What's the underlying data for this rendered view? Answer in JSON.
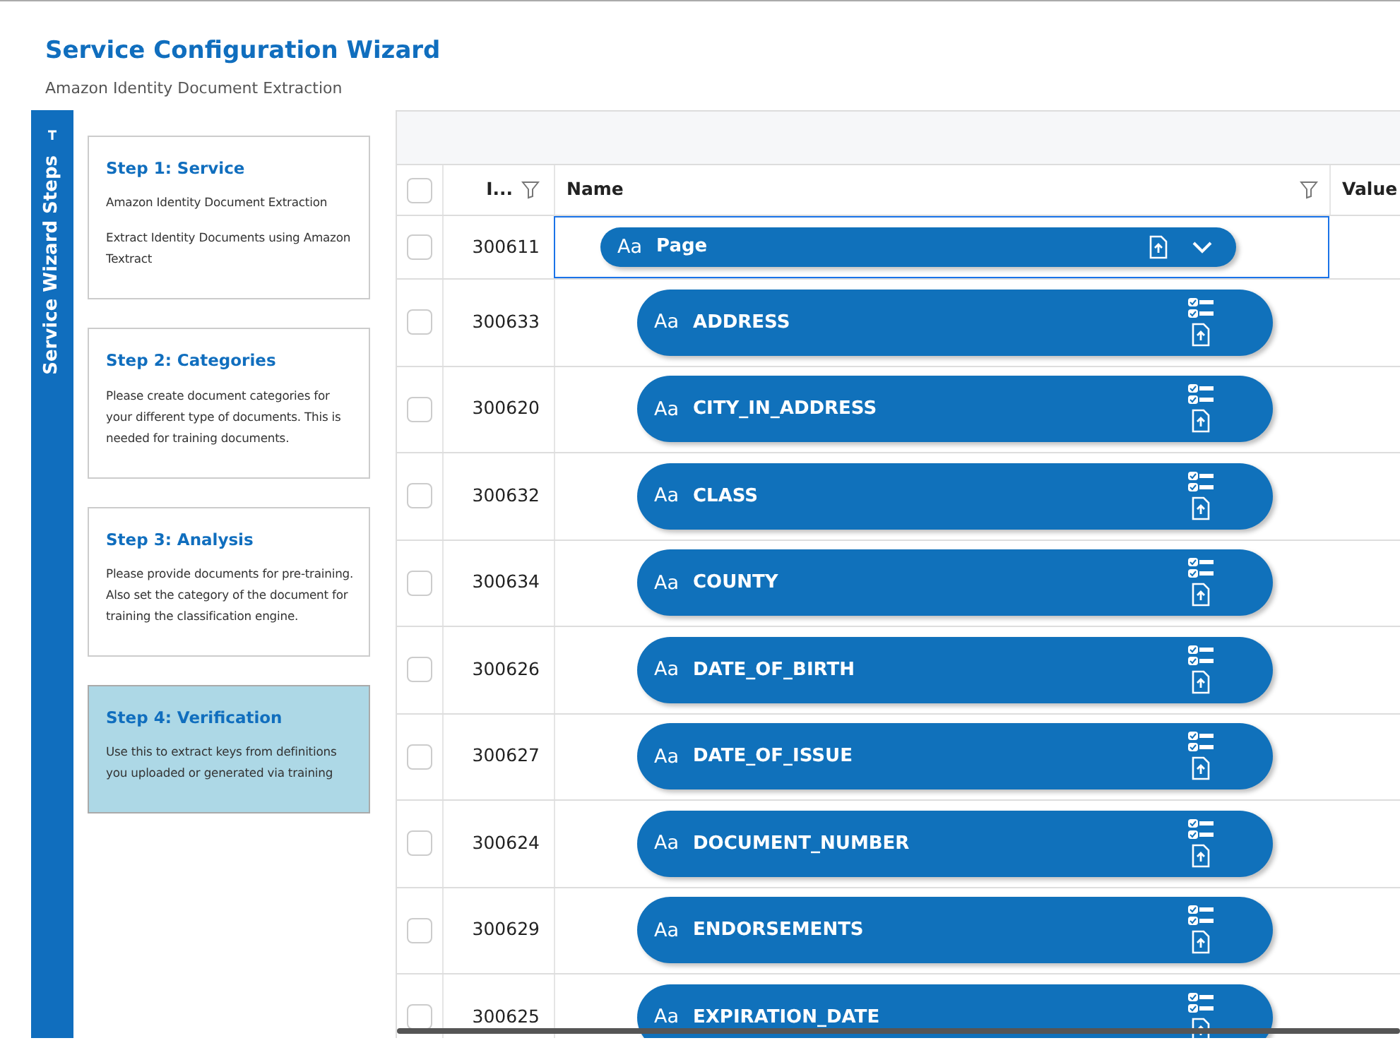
{
  "window": {
    "title": "Service Configuration Wizard",
    "subtitle": "Amazon Identity Document Extraction"
  },
  "sidebar": {
    "title": "Service Wizard Steps"
  },
  "steps": [
    {
      "title": "Step 1: Service",
      "lines": [
        "Amazon Identity Document Extraction",
        "Extract Identity Documents using Amazon Textract"
      ],
      "selected": false
    },
    {
      "title": "Step 2: Categories",
      "lines": [
        "Please create document categories for your different type of documents. This is needed for training documents."
      ],
      "selected": false
    },
    {
      "title": "Step 3: Analysis",
      "lines": [
        "Please provide documents for pre-training. Also set the category of the document for training the classification engine."
      ],
      "selected": false
    },
    {
      "title": "Step 4: Verification",
      "lines": [
        "Use this to extract keys from definitions you uploaded or generated via training"
      ],
      "selected": true
    }
  ],
  "table": {
    "all_checked": false,
    "columns": [
      "I...",
      "Name",
      "Value"
    ],
    "rows": [
      {
        "id": "300611",
        "type_label": "Aa",
        "name": "Page",
        "kind": "parent",
        "expanded": true,
        "checked": false,
        "selected": true
      },
      {
        "id": "300633",
        "type_label": "Aa",
        "name": "ADDRESS",
        "kind": "child",
        "checked": false,
        "selected": false
      },
      {
        "id": "300620",
        "type_label": "Aa",
        "name": "CITY_IN_ADDRESS",
        "kind": "child",
        "checked": false,
        "selected": false
      },
      {
        "id": "300632",
        "type_label": "Aa",
        "name": "CLASS",
        "kind": "child",
        "checked": false,
        "selected": false
      },
      {
        "id": "300634",
        "type_label": "Aa",
        "name": "COUNTY",
        "kind": "child",
        "checked": false,
        "selected": false
      },
      {
        "id": "300626",
        "type_label": "Aa",
        "name": "DATE_OF_BIRTH",
        "kind": "child",
        "checked": false,
        "selected": false
      },
      {
        "id": "300627",
        "type_label": "Aa",
        "name": "DATE_OF_ISSUE",
        "kind": "child",
        "checked": false,
        "selected": false
      },
      {
        "id": "300624",
        "type_label": "Aa",
        "name": "DOCUMENT_NUMBER",
        "kind": "child",
        "checked": false,
        "selected": false
      },
      {
        "id": "300629",
        "type_label": "Aa",
        "name": "ENDORSEMENTS",
        "kind": "child",
        "checked": false,
        "selected": false
      },
      {
        "id": "300625",
        "type_label": "Aa",
        "name": "EXPIRATION_DATE",
        "kind": "child",
        "checked": false,
        "selected": false
      }
    ]
  }
}
